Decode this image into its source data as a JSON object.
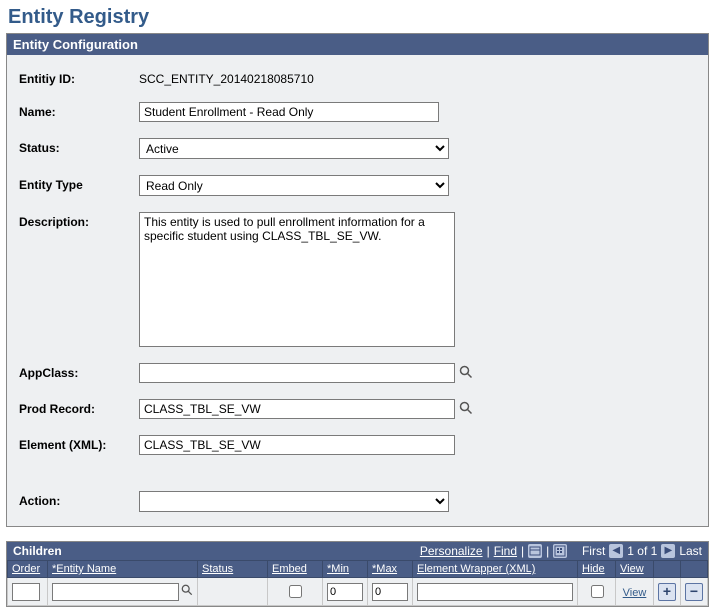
{
  "page": {
    "title": "Entity Registry"
  },
  "config": {
    "section_title": "Entity Configuration",
    "labels": {
      "entity_id": "Entitiy ID:",
      "name": "Name:",
      "status": "Status:",
      "entity_type": "Entity Type",
      "description": "Description:",
      "app_class": "AppClass:",
      "prod_record": "Prod Record:",
      "element_xml": "Element (XML):",
      "action": "Action:"
    },
    "values": {
      "entity_id": "SCC_ENTITY_20140218085710",
      "name": "Student Enrollment - Read Only",
      "status": "Active",
      "entity_type": "Read Only",
      "description": "This entity is used to pull enrollment information for a specific student using CLASS_TBL_SE_VW.",
      "app_class": "",
      "prod_record": "CLASS_TBL_SE_VW",
      "element_xml": "CLASS_TBL_SE_VW",
      "action": ""
    }
  },
  "children": {
    "section_title": "Children",
    "toolbar": {
      "personalize": "Personalize",
      "find": "Find",
      "first": "First",
      "counter": "1 of 1",
      "last": "Last"
    },
    "columns": {
      "order": "Order",
      "entity_name": "*Entity Name",
      "status": "Status",
      "embed": "Embed",
      "min": "*Min",
      "max": "*Max",
      "element_wrapper": "Element Wrapper (XML)",
      "hide": "Hide",
      "view": "View"
    },
    "rows": [
      {
        "order": "",
        "entity_name": "",
        "status": "",
        "embed": false,
        "min": "0",
        "max": "0",
        "element_wrapper": "",
        "hide": false,
        "view_label": "View"
      }
    ]
  }
}
